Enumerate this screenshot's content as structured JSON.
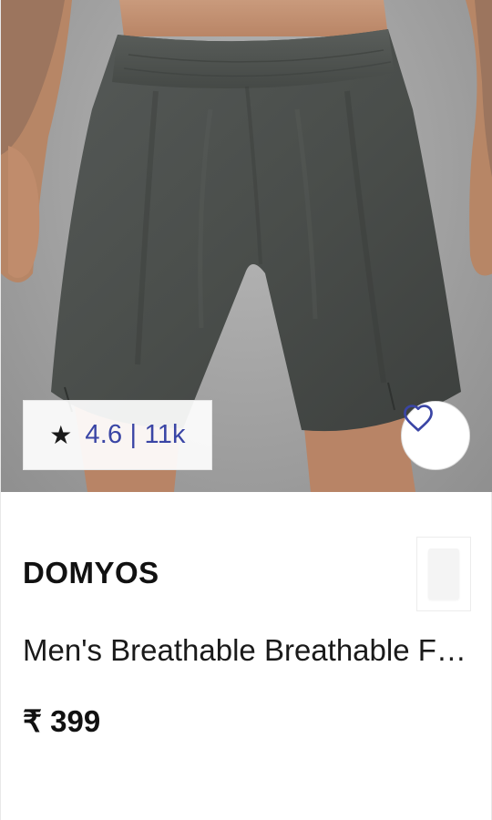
{
  "product_card": {
    "image": {
      "alt": "Dark grey athletic shorts worn by a model",
      "shorts_color": "#4a4e4b",
      "background_color": "#a8a8a8"
    },
    "rating": {
      "star_glyph": "★",
      "text": "4.6 | 11k"
    },
    "wishlist": {
      "icon": "heart-outline-icon"
    },
    "brand": "DOMYOS",
    "title": "Men's Breathable Breathable Football Shorts",
    "price": "₹ 399",
    "colors": {
      "rating_text": "#3a45a5",
      "accent_icon": "#3a45a5"
    }
  }
}
